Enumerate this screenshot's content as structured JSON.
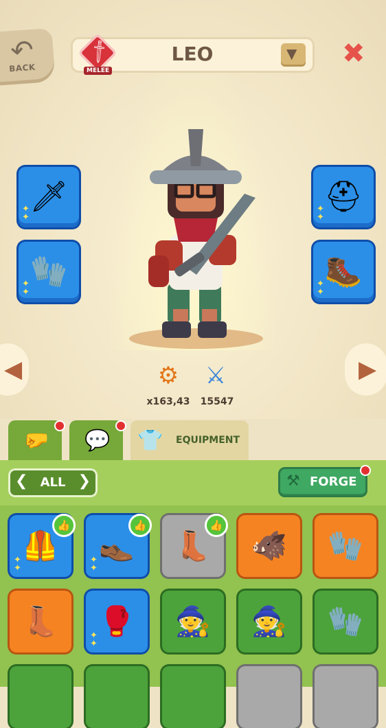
{
  "header": {
    "back_label": "BACK",
    "back_icon": "curved-arrow-icon",
    "class_label": "MELEE",
    "class_icon": "sword-icon",
    "hero_name": "LEO",
    "dropdown_icon": "▼",
    "close_icon": "✖"
  },
  "equipment_slots": [
    {
      "name": "weapon",
      "icon": "🗡",
      "stars": "✦\n✦"
    },
    {
      "name": "gloves",
      "icon": "🧤",
      "stars": "✦\n✦"
    },
    {
      "name": "helmet",
      "icon": "⛑",
      "stars": "✦\n✦"
    },
    {
      "name": "boots",
      "icon": "🥾",
      "stars": "✦\n✦"
    }
  ],
  "navigation": {
    "prev": "◀",
    "next": "▶"
  },
  "stats": [
    {
      "name": "power-multiplier",
      "icon": "⚙",
      "value": "x163,43"
    },
    {
      "name": "battle-power",
      "icon": "⚔",
      "value": "15547"
    }
  ],
  "tabs": {
    "upgrade_icon": "🤛",
    "chat_icon": "💬",
    "equipment_icon": "👕",
    "equipment_label": "EQUIPMENT"
  },
  "filter": {
    "left": "❮",
    "label": "ALL",
    "right": "❯"
  },
  "forge": {
    "icon": "⚒",
    "label": "FORGE"
  },
  "inventory": [
    {
      "rarity": "blue",
      "icon": "🦺",
      "stars": true,
      "recommended": true
    },
    {
      "rarity": "blue",
      "icon": "👞",
      "stars": true,
      "recommended": true
    },
    {
      "rarity": "gray",
      "icon": "👢",
      "stars": false,
      "recommended": true
    },
    {
      "rarity": "orange",
      "icon": "🐗",
      "stars": false,
      "recommended": false
    },
    {
      "rarity": "orange",
      "icon": "🧤",
      "stars": false,
      "recommended": false
    },
    {
      "rarity": "orange",
      "icon": "👢",
      "stars": false,
      "recommended": false
    },
    {
      "rarity": "blue",
      "icon": "🥊",
      "stars": true,
      "recommended": false
    },
    {
      "rarity": "green",
      "icon": "🧙",
      "stars": false,
      "recommended": false
    },
    {
      "rarity": "green",
      "icon": "🧙",
      "stars": false,
      "recommended": false
    },
    {
      "rarity": "green",
      "icon": "🧤",
      "stars": false,
      "recommended": false
    }
  ],
  "colors": {
    "background": "#efe3c6",
    "panel_green": "#90c34e",
    "accent_red": "#e5534b",
    "blue_rarity": "#2b8fe8",
    "orange_rarity": "#f58322",
    "green_rarity": "#4ca33b",
    "gray_rarity": "#a9a9a9"
  }
}
